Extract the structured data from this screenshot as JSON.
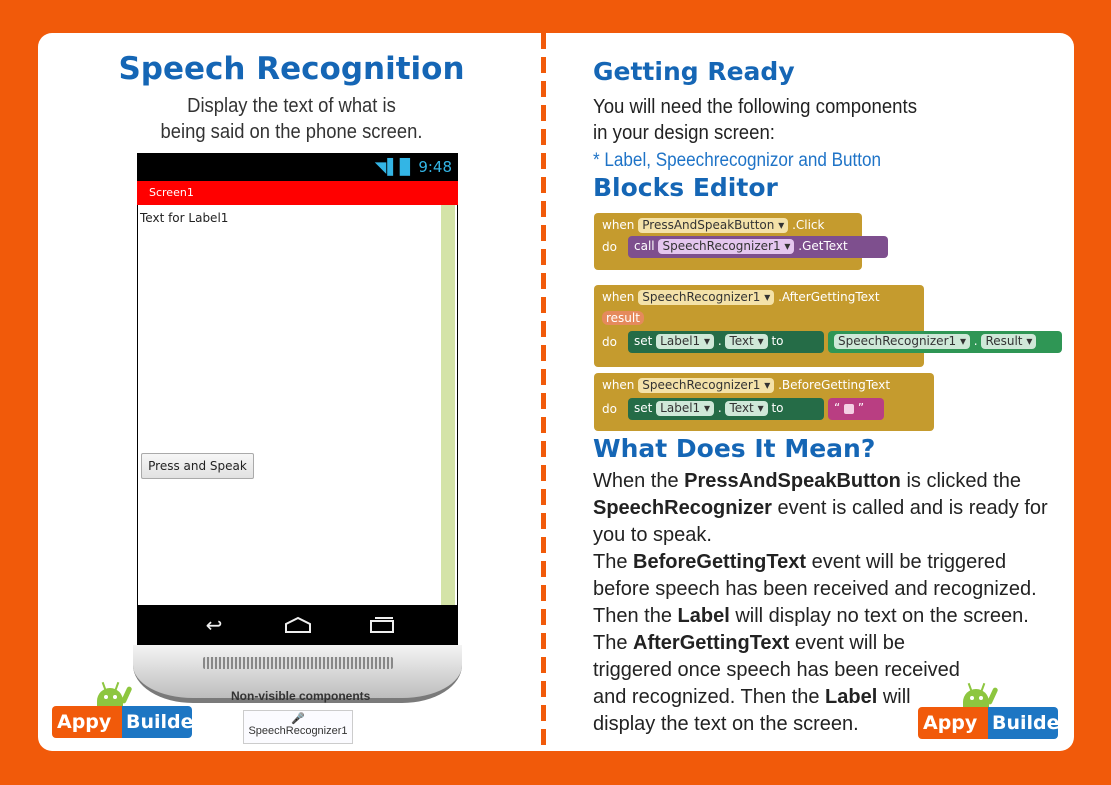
{
  "left": {
    "title": "Speech Recognition",
    "subtitle_line1": "Display the text of what is",
    "subtitle_line2": "being said on the phone screen.",
    "phone": {
      "time": "9:48",
      "screen_title": "Screen1",
      "label_text": "Text for Label1",
      "button_label": "Press and Speak"
    },
    "nonvisible_title": "Non-visible components",
    "nonvisible_item": "SpeechRecognizer1"
  },
  "logo": {
    "part1": "Appy",
    "part2": "Builder"
  },
  "right": {
    "getting_ready_title": "Getting Ready",
    "getting_ready_line1": "You will need the following components",
    "getting_ready_line2": "in your design screen:",
    "components_line": "* Label, Speechrecognizor and Button",
    "blocks_title": "Blocks Editor",
    "meaning_title": "What Does It Mean?"
  },
  "blocks": {
    "when": "when",
    "do": "do",
    "call": "call",
    "set": "set",
    "to": "to",
    "b1_component": "PressAndSpeakButton",
    "b1_event": ".Click",
    "b1_call_component": "SpeechRecognizer1",
    "b1_method": ".GetText",
    "b2_component": "SpeechRecognizer1",
    "b2_event": ".AfterGettingText",
    "b2_param": "result",
    "b2_set_component": "Label1",
    "b2_property": "Text",
    "b2_value_component": "SpeechRecognizer1",
    "b2_value_property": "Result",
    "b3_component": "SpeechRecognizer1",
    "b3_event": ".BeforeGettingText",
    "b3_set_component": "Label1",
    "b3_property": "Text"
  },
  "explanation": {
    "p1_a": "When the ",
    "p1_b": "PressAndSpeakButton",
    "p1_c": " is clicked the",
    "p2_a": "SpeechRecognizer",
    "p2_b": " event is called and is ready for",
    "p3": "you to speak.",
    "p4_a": "The ",
    "p4_b": "BeforeGettingText",
    "p4_c": " event will be triggered",
    "p5": "before speech has been received and recognized.",
    "p6_a": "Then the ",
    "p6_b": "Label",
    "p6_c": " will display no text on the screen.",
    "p7_a": "The ",
    "p7_b": "AfterGettingText",
    "p7_c": " event will be",
    "p8": "triggered once speech has been received",
    "p9_a": "and recognized. Then the ",
    "p9_b": "Label",
    "p9_c": " will",
    "p10": "display the text on the screen."
  },
  "colors": {
    "background": "#f15a0a",
    "heading": "#1566b5",
    "block_event": "#c59b2e",
    "block_set": "#256c47",
    "block_call": "#7e4f8e"
  }
}
